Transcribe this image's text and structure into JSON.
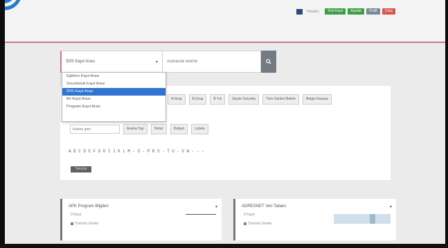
{
  "header": {
    "user_text": "Yönetici",
    "actions": [
      {
        "label": "Yeni Kayıt",
        "color": "#3f9e44"
      },
      {
        "label": "Ayarlar",
        "color": "#3f9e44"
      },
      {
        "label": "Profil",
        "color": "#7a8a94"
      },
      {
        "label": "Çıkış",
        "color": "#d9534f"
      }
    ],
    "accent": "#c8739f"
  },
  "search": {
    "selected": "IDIS Kayıt Arası",
    "placeholder": "Aranacak kelime",
    "options": [
      "Egitimci Kayıt Arası",
      "Sorumluluk Kayıt Arası",
      "IDIS Kayıt Arası",
      "Bir Kayıt Arası",
      "Program Kayıt Arası"
    ],
    "selected_index": 2,
    "highlight_color": "#2f74cf"
  },
  "filter_buttons": [
    "A Grup",
    "B Grup",
    "B Yılı",
    "Seçim Sorumlu",
    "Tüm Günleri Belirle",
    "Belge Dosyası"
  ],
  "filter_row": {
    "input_placeholder": "Kelime girin",
    "buttons": [
      "Arama Yap",
      "Temiz",
      "Detaylı",
      "Listele"
    ]
  },
  "alphabet": [
    "A",
    "B",
    "C",
    "D",
    "E",
    "F",
    "G",
    "H",
    "I",
    "J",
    "K",
    "L",
    "M",
    "-",
    "O",
    "-",
    "P",
    "R",
    "S",
    "-",
    "T",
    "U",
    "-",
    "V",
    "W",
    "-",
    "-",
    "-"
  ],
  "clear_button": "Temizle",
  "cards": [
    {
      "title": "APK Program Bilgileri",
      "subtitle": "0 Kayıt",
      "link": "Tümünü Göster"
    },
    {
      "title": "ADRESNET Veri Tabanı",
      "subtitle": "0 Kayıt",
      "link": "Tümünü Göster"
    }
  ]
}
